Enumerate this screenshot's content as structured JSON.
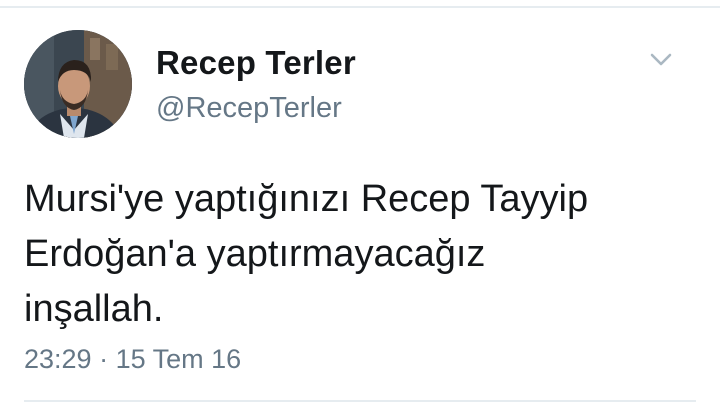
{
  "author": {
    "display_name": "Recep Terler",
    "handle": "@RecepTerler"
  },
  "tweet": {
    "lines": [
      "Mursi'ye yaptığınızı Recep Tayyip",
      "Erdoğan'a yaptırmayacağız",
      "inşallah."
    ],
    "time": "23:29",
    "separator": "·",
    "date": "15 Tem 16"
  },
  "icons": {
    "menu": "chevron-down-icon",
    "avatar": "profile-photo"
  },
  "colors": {
    "text_primary": "#14171a",
    "text_secondary": "#657786",
    "divider": "#e6ecf0",
    "caret": "#aab8c2"
  }
}
